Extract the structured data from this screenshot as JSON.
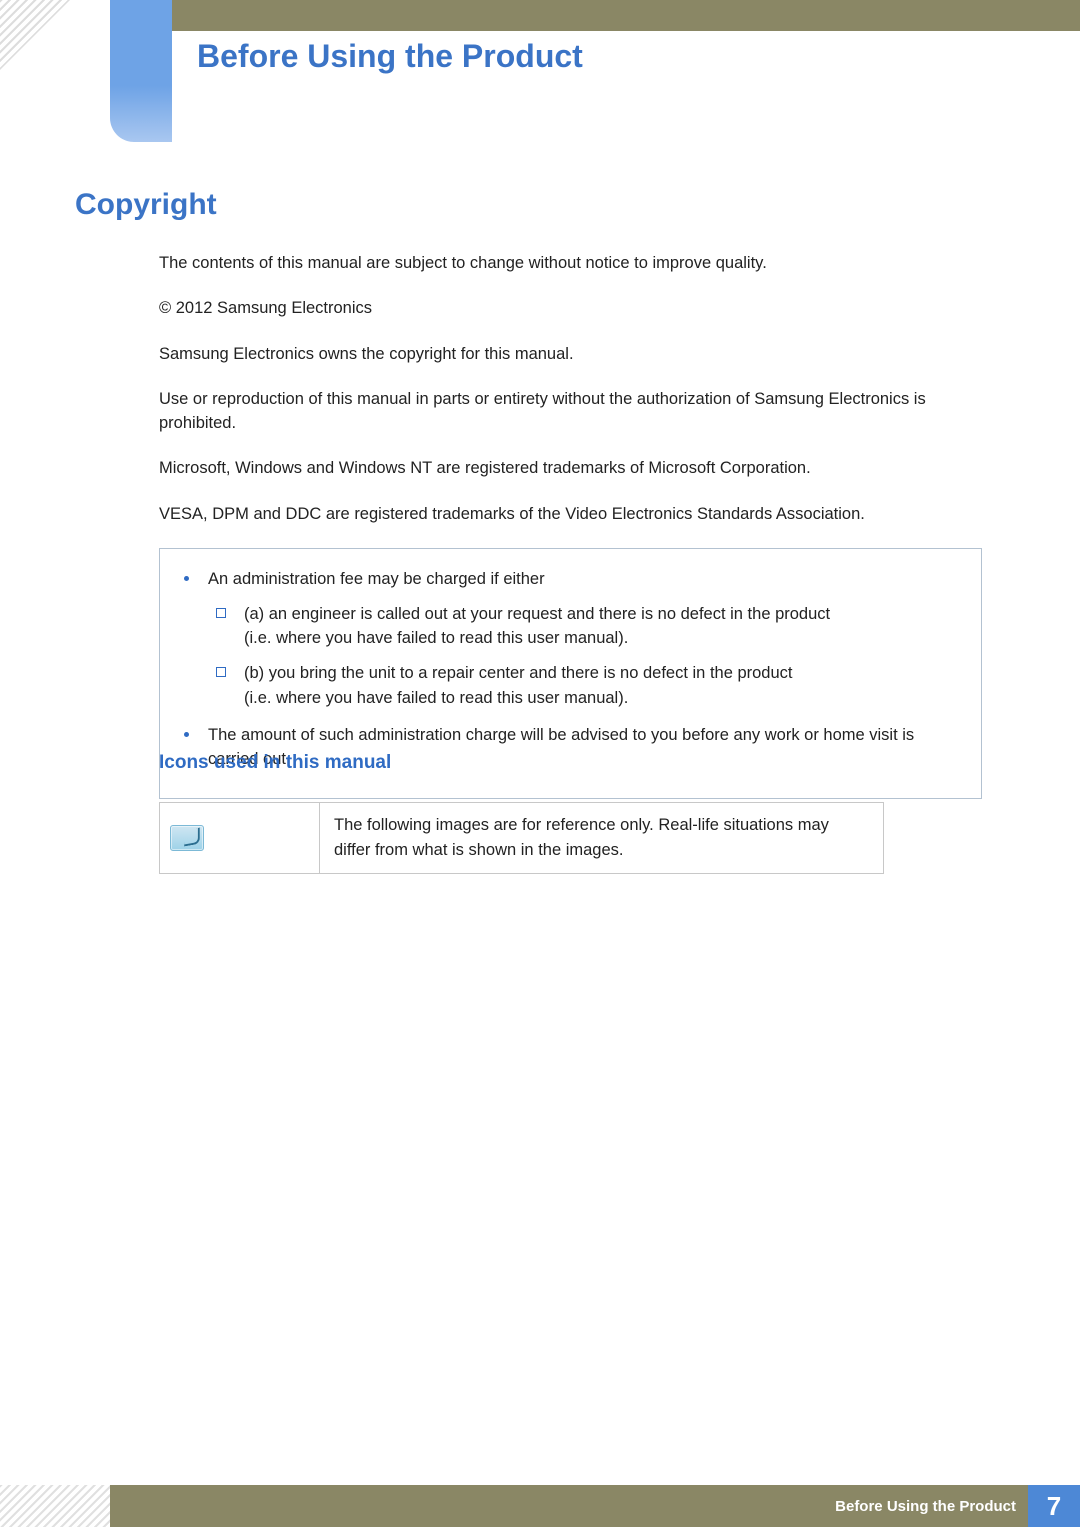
{
  "chapter_title": "Before Using the Product",
  "section_title": "Copyright",
  "paragraphs": {
    "p1": "The contents of this manual are subject to change without notice to improve quality.",
    "p2": "© 2012 Samsung Electronics",
    "p3": "Samsung Electronics owns the copyright for this manual.",
    "p4": "Use or reproduction of this manual in parts or entirety without the authorization of Samsung Electronics is prohibited.",
    "p5": "Microsoft, Windows and Windows NT are registered trademarks of Microsoft Corporation.",
    "p6": "VESA, DPM and DDC are registered trademarks of the Video Electronics Standards Association."
  },
  "note_box": {
    "items": [
      {
        "text": "An administration fee may be charged if either",
        "sub": [
          {
            "line1": "(a) an engineer is called out at your request and there is no defect in the product",
            "line2": "(i.e. where you have failed to read this user manual)."
          },
          {
            "line1": "(b) you bring the unit to a repair center and there is no defect in the product",
            "line2": "(i.e. where you have failed to read this user manual)."
          }
        ]
      },
      {
        "text": "The amount of such administration charge will be advised to you before any work or home visit is carried out."
      }
    ]
  },
  "icons_heading": "Icons used in this manual",
  "icons_table": {
    "icon_name": "reference-note-icon",
    "description": "The following images are for reference only. Real-life situations may differ from what is shown in the images."
  },
  "footer": {
    "label": "Before Using the Product",
    "page": "7"
  }
}
